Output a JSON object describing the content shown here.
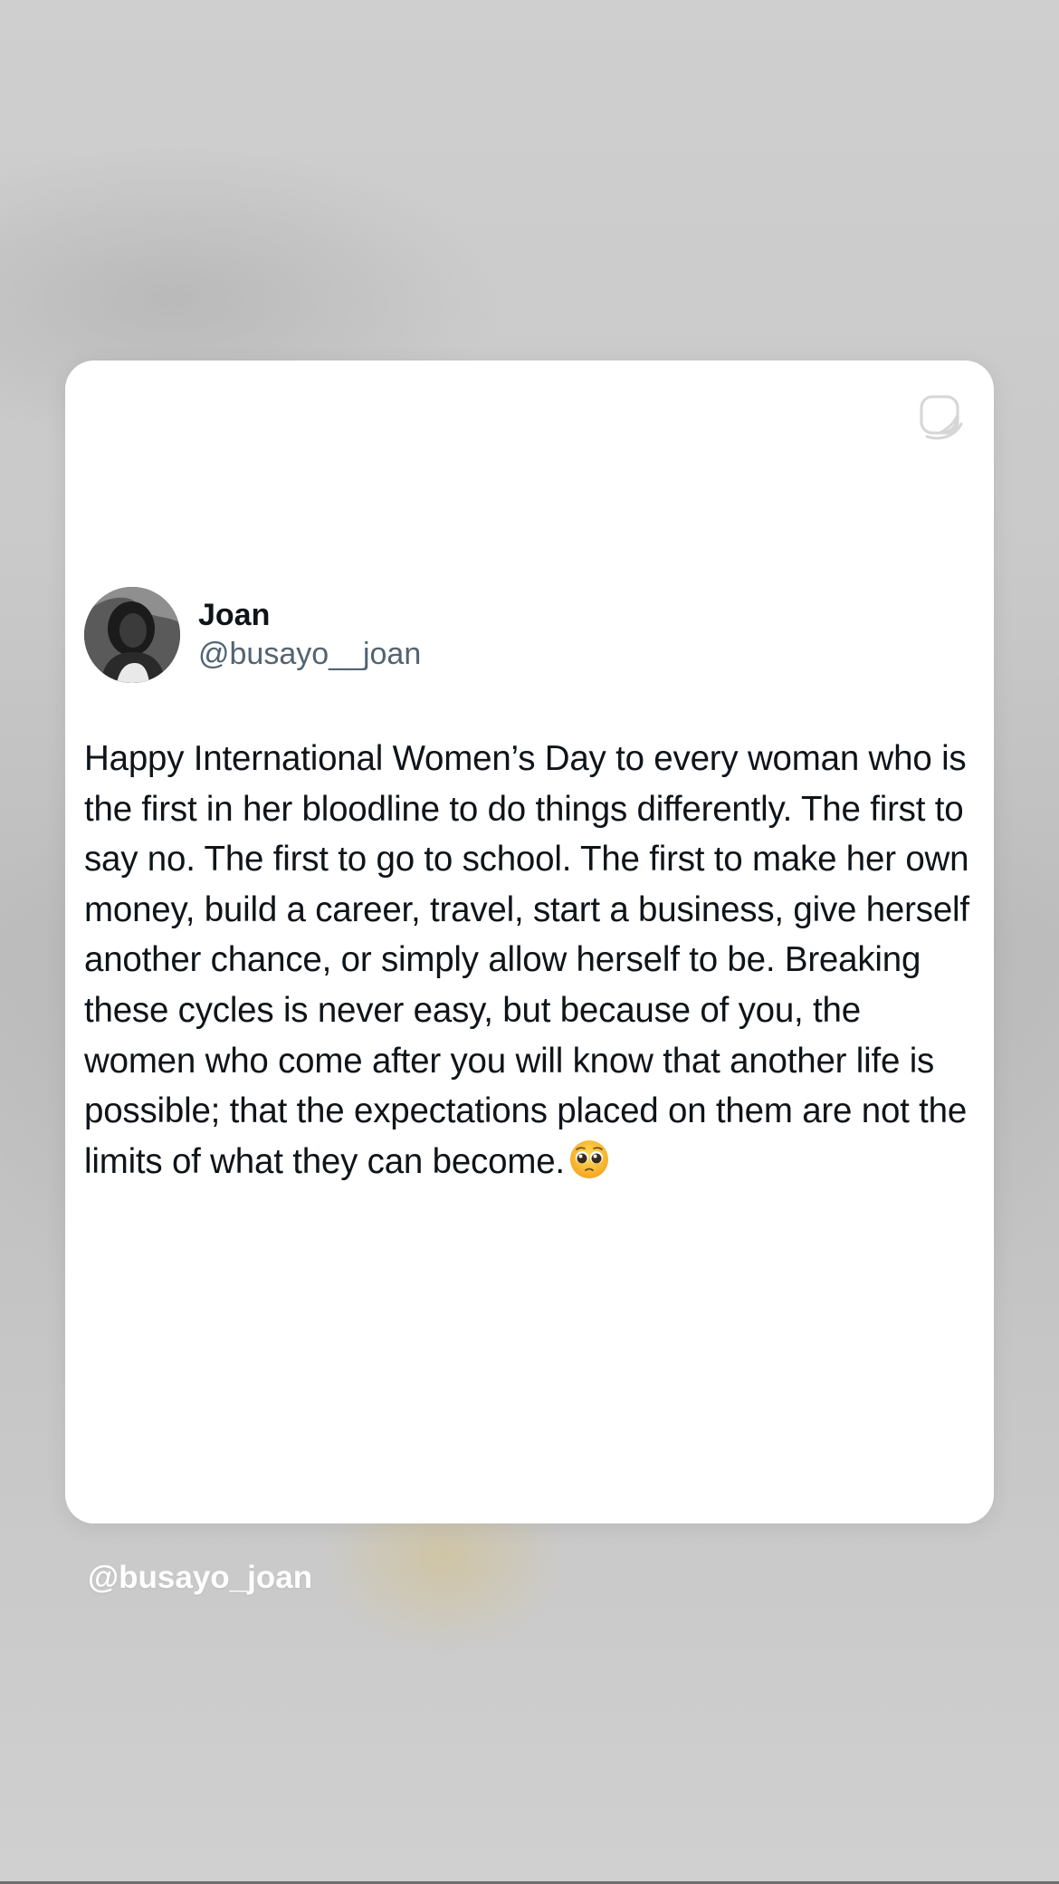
{
  "post": {
    "display_name": "Joan",
    "handle": "@busayo__joan",
    "text": "Happy International Women’s Day to every woman who is the first in her bloodline to do things differently. The first to say no. The first to go to school. The first to make her own money, build a career, travel, start a business, give herself another chance, or simply allow herself to be. Breaking these cycles is never easy, but because of you, the women who come after you will know that another life is possible; that the expectations placed on them are not the limits of what they can become.",
    "emoji": "pleading-face"
  },
  "story": {
    "mention": "@busayo_joan",
    "sticker_icon": "sticker-icon"
  },
  "colors": {
    "background": "#cdcdcd",
    "card": "#ffffff",
    "text_primary": "#0f1419",
    "text_secondary": "#536471",
    "mention": "#ffffff"
  }
}
